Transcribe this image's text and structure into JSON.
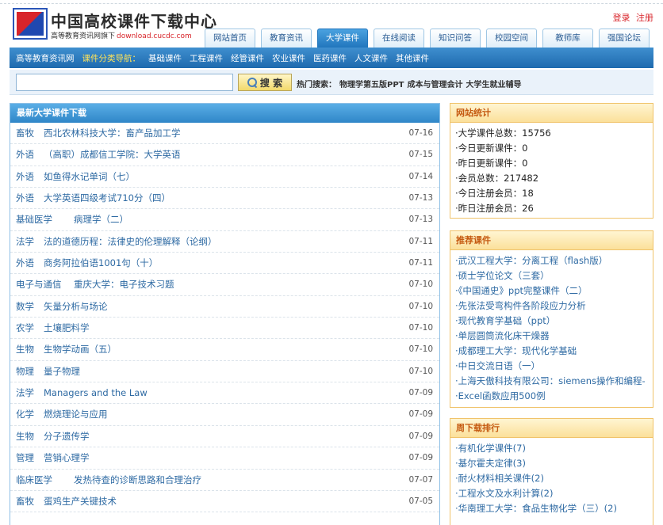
{
  "header": {
    "site_title": "中国高校课件下载中心",
    "slogan": "高等教育资讯网旗下",
    "slogan_domain": "download.cucdc.com",
    "login": "登录",
    "register": "注册"
  },
  "nav": {
    "tabs": [
      {
        "label": "网站首页"
      },
      {
        "label": "教育资讯"
      },
      {
        "label": "大学课件"
      },
      {
        "label": "在线阅读"
      },
      {
        "label": "知识问答"
      },
      {
        "label": "校园空间"
      },
      {
        "label": "教师库"
      },
      {
        "label": "强国论坛"
      }
    ]
  },
  "subnav": {
    "site_link": "高等教育资讯网",
    "guide_label": "课件分类导航：",
    "items": [
      {
        "label": "基础课件"
      },
      {
        "label": "工程课件"
      },
      {
        "label": "经管课件"
      },
      {
        "label": "农业课件"
      },
      {
        "label": "医药课件"
      },
      {
        "label": "人文课件"
      },
      {
        "label": "其他课件"
      }
    ]
  },
  "search": {
    "value": "",
    "button_label": "搜 索",
    "hot_label": "热门搜索：",
    "hot_keywords": [
      {
        "label": "物理学第五版PPT"
      },
      {
        "label": "成本与管理会计"
      },
      {
        "label": "大学生就业辅导"
      }
    ]
  },
  "latest": {
    "heading": "最新大学课件下载",
    "rows": [
      {
        "category": "畜牧",
        "title": "西北农林科技大学：畜产品加工学",
        "date": "07-16"
      },
      {
        "category": "外语",
        "title": "（高职）成都信工学院：大学英语",
        "date": "07-15"
      },
      {
        "category": "外语",
        "title": "如鱼得水记单词（七）",
        "date": "07-14"
      },
      {
        "category": "外语",
        "title": "大学英语四级考试710分（四）",
        "date": "07-13"
      },
      {
        "category": "基础医学",
        "title": "病理学（二）",
        "date": "07-13"
      },
      {
        "category": "法学",
        "title": "法的道德历程：法律史的伦理解释（论纲）",
        "date": "07-11"
      },
      {
        "category": "外语",
        "title": "商务阿拉伯语1001句（十）",
        "date": "07-11"
      },
      {
        "category": "电子与通信",
        "title": "重庆大学：电子技术习题",
        "date": "07-10"
      },
      {
        "category": "数学",
        "title": "矢量分析与场论",
        "date": "07-10"
      },
      {
        "category": "农学",
        "title": "土壤肥料学",
        "date": "07-10"
      },
      {
        "category": "生物",
        "title": "生物学动画（五）",
        "date": "07-10"
      },
      {
        "category": "物理",
        "title": "量子物理",
        "date": "07-10"
      },
      {
        "category": "法学",
        "title": "Managers and the Law",
        "date": "07-09"
      },
      {
        "category": "化学",
        "title": "燃烧理论与应用",
        "date": "07-09"
      },
      {
        "category": "生物",
        "title": "分子遗传学",
        "date": "07-09"
      },
      {
        "category": "管理",
        "title": "营销心理学",
        "date": "07-09"
      },
      {
        "category": "临床医学",
        "title": "发热待查的诊断思路和合理治疗",
        "date": "07-07"
      },
      {
        "category": "畜牧",
        "title": "蛋鸡生产关键技术",
        "date": "07-05"
      }
    ]
  },
  "stats": {
    "heading": "网站统计",
    "items": [
      {
        "text": "·大学课件总数：15756"
      },
      {
        "text": "·今日更新课件：0"
      },
      {
        "text": "·昨日更新课件：0"
      },
      {
        "text": "·会员总数：217482"
      },
      {
        "text": "·今日注册会员：18"
      },
      {
        "text": "·昨日注册会员：26"
      }
    ]
  },
  "recommended": {
    "heading": "推荐课件",
    "items": [
      {
        "text": "·武汉工程大学：分离工程（flash版）"
      },
      {
        "text": "·硕士学位论文（三套）"
      },
      {
        "text": "·《中国通史》ppt完整课件（二）"
      },
      {
        "text": "·先张法受弯构件各阶段应力分析"
      },
      {
        "text": "·现代教育学基础（ppt）"
      },
      {
        "text": "·单层圆筒流化床干燥器"
      },
      {
        "text": "·成都理工大学：现代化学基础"
      },
      {
        "text": "·中日交流日语（一）"
      },
      {
        "text": "·上海天傲科技有限公司：siemens操作和编程-"
      },
      {
        "text": "·Excel函数应用500例"
      }
    ]
  },
  "weekly": {
    "heading": "周下载排行",
    "items": [
      {
        "text": "·有机化学课件(7)"
      },
      {
        "text": "·基尔霍夫定律(3)"
      },
      {
        "text": "·耐火材料相关课件(2)"
      },
      {
        "text": "·工程水文及水利计算(2)"
      },
      {
        "text": "·华南理工大学：食品生物化学（三）(2)"
      }
    ]
  }
}
